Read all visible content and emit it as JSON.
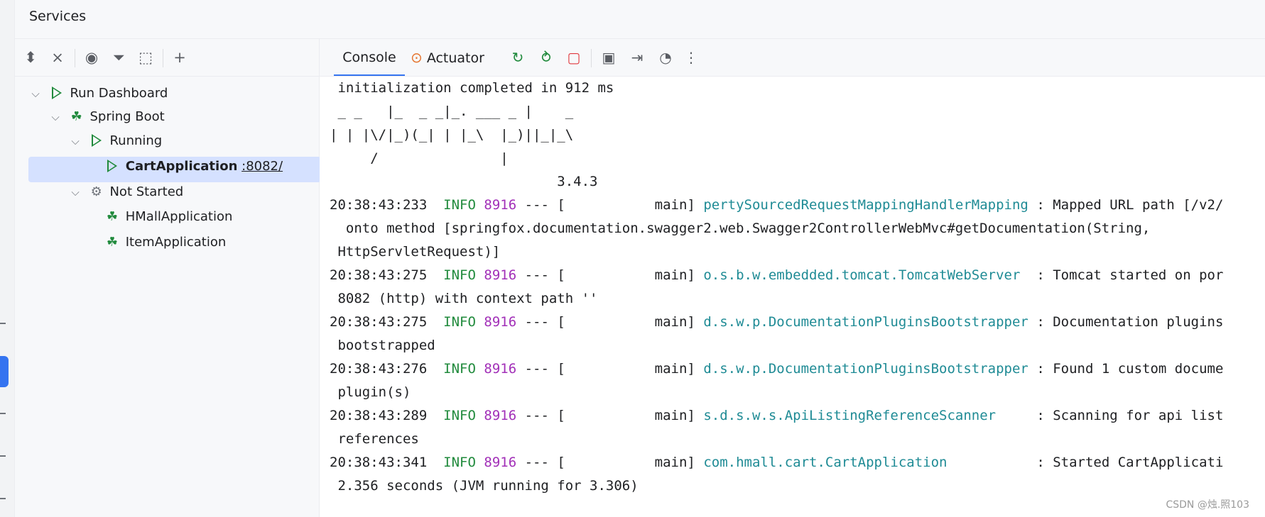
{
  "window": {
    "title": "Services"
  },
  "left_toolbar": {
    "icons": [
      "expand-all-icon",
      "collapse-all-icon",
      "eye-icon",
      "filter-icon",
      "new-group-icon",
      "add-service-icon"
    ]
  },
  "tree": {
    "run_dashboard": "Run Dashboard",
    "spring_boot": "Spring Boot",
    "running": "Running",
    "cart_app": "CartApplication",
    "cart_port": ":8082/",
    "not_started": "Not Started",
    "hmall_app": "HMallApplication",
    "item_app": "ItemApplication"
  },
  "right_toolbar": {
    "tab_console": "Console",
    "tab_actuator": "Actuator",
    "icons": [
      "rerun-icon",
      "rerun-debug-icon",
      "stop-icon",
      "screenshot-icon",
      "login-icon",
      "dashboard-icon",
      "more-icon"
    ]
  },
  "console": {
    "lines": [
      " initialization completed in 912 ms",
      " _ _   |_  _ _|_. ___ _ |    _",
      "| | |\\/|_)(_| | |_\\  |_)||_|_\\",
      "     /               |",
      "                            3.4.3"
    ],
    "logs": [
      {
        "ts": "20:38:43:233",
        "level": "INFO",
        "pid": "8916",
        "sep": "--- [",
        "thread": "main]",
        "logger": "pertySourcedRequestMappingHandlerMapping",
        "msg": " : Mapped URL path [/v2/",
        "cont": [
          "  onto method [springfox.documentation.swagger2.web.Swagger2ControllerWebMvc#getDocumentation(String,",
          " HttpServletRequest)]"
        ]
      },
      {
        "ts": "20:38:43:275",
        "level": "INFO",
        "pid": "8916",
        "sep": "--- [",
        "thread": "main]",
        "logger": "o.s.b.w.embedded.tomcat.TomcatWebServer ",
        "msg": " : Tomcat started on por",
        "cont": [
          " 8082 (http) with context path ''"
        ]
      },
      {
        "ts": "20:38:43:275",
        "level": "INFO",
        "pid": "8916",
        "sep": "--- [",
        "thread": "main]",
        "logger": "d.s.w.p.DocumentationPluginsBootstrapper",
        "msg": " : Documentation plugins",
        "cont": [
          " bootstrapped"
        ]
      },
      {
        "ts": "20:38:43:276",
        "level": "INFO",
        "pid": "8916",
        "sep": "--- [",
        "thread": "main]",
        "logger": "d.s.w.p.DocumentationPluginsBootstrapper",
        "msg": " : Found 1 custom docume",
        "cont": [
          " plugin(s)"
        ]
      },
      {
        "ts": "20:38:43:289",
        "level": "INFO",
        "pid": "8916",
        "sep": "--- [",
        "thread": "main]",
        "logger": "s.d.s.w.s.ApiListingReferenceScanner    ",
        "msg": " : Scanning for api list",
        "cont": [
          " references"
        ]
      },
      {
        "ts": "20:38:43:341",
        "level": "INFO",
        "pid": "8916",
        "sep": "--- [",
        "thread": "main]",
        "logger": "com.hmall.cart.CartApplication          ",
        "msg": " : Started CartApplicati",
        "cont": [
          " 2.356 seconds (JVM running for 3.306)"
        ]
      }
    ]
  },
  "watermark": "CSDN @烛.照103"
}
